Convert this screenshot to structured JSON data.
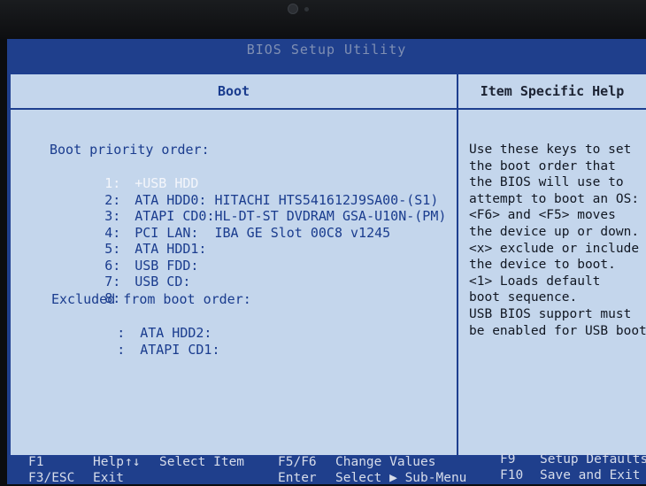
{
  "bios_title": "BIOS Setup Utility",
  "boot_panel": {
    "heading": "Boot",
    "priority_label": "Boot priority order:",
    "priority_items": [
      {
        "number": "1:",
        "device": "+USB HDD",
        "selected": true
      },
      {
        "number": "2:",
        "device": "ATA HDD0: HITACHI HTS541612J9SA00-(S1)"
      },
      {
        "number": "3:",
        "device": "ATAPI CD0:HL-DT-ST DVDRAM GSA-U10N-(PM)"
      },
      {
        "number": "4:",
        "device": "PCI LAN:  IBA GE Slot 00C8 v1245"
      },
      {
        "number": "5:",
        "device": "ATA HDD1:"
      },
      {
        "number": "6:",
        "device": "USB FDD:"
      },
      {
        "number": "7:",
        "device": "USB CD:"
      },
      {
        "number": "8:",
        "device": ""
      }
    ],
    "excluded_label": "Excluded from boot order:",
    "excluded_items": [
      {
        "marker": ":",
        "device": "ATA HDD2:"
      },
      {
        "marker": ":",
        "device": "ATAPI CD1:"
      }
    ]
  },
  "help_panel": {
    "heading": "Item Specific Help",
    "lines": [
      "Use these keys to set",
      "the boot order that",
      "the BIOS will use to",
      "attempt to boot an OS:",
      "<F6> and <F5> moves",
      "the device up or down.",
      "<x> exclude or include",
      "the device to boot.",
      "<1> Loads default",
      "boot sequence.",
      "USB BIOS support must",
      "be enabled for USB boot."
    ]
  },
  "footer": {
    "f1_key": "F1",
    "f1_desc": "Help",
    "updown_key": "↑↓",
    "updown_desc": "Select Item",
    "f5f6_key": "F5/F6",
    "f5f6_desc": "Change Values",
    "f9_key": "F9",
    "f9_desc": "Setup Defaults",
    "f3esc_key": "F3/ESC",
    "f3esc_desc": "Exit",
    "enter_key": "Enter",
    "enter_desc": "Select ▶ Sub-Menu",
    "f10_key": "F10",
    "f10_desc": "Save and Exit"
  },
  "colors": {
    "frame_blue": "#1f3f8c",
    "panel_bg": "#c4d6ec",
    "text_blue": "#1a3c8e",
    "selected_text": "#f4f6fb"
  }
}
